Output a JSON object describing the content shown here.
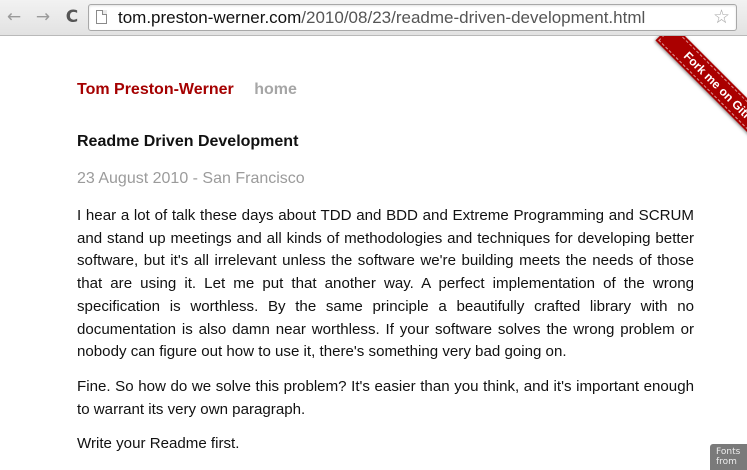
{
  "browser": {
    "url_domain": "tom.preston-werner.com",
    "url_path": "/2010/08/23/readme-driven-development.html",
    "back_icon": "←",
    "forward_icon": "→",
    "reload_icon": "C",
    "bookmark_icon": "☆"
  },
  "ribbon": {
    "label": "Fork me on GitHub"
  },
  "header": {
    "site_title": "Tom Preston-Werner",
    "home_link": "home"
  },
  "post": {
    "title": "Readme Driven Development",
    "meta": "23 August 2010 - San Francisco",
    "paragraphs": [
      "I hear a lot of talk these days about TDD and BDD and Extreme Programming and SCRUM and stand up meetings and all kinds of methodologies and techniques for developing better software, but it's all irrelevant unless the software we're building meets the needs of those that are using it. Let me put that another way. A perfect implementation of the wrong specification is worthless. By the same principle a beautifully crafted library with no documentation is also damn near worthless. If your software solves the wrong problem or nobody can figure out how to use it, there's something very bad going on.",
      "Fine. So how do we solve this problem? It's easier than you think, and it's important enough to warrant its very own paragraph.",
      "Write your Readme first."
    ]
  },
  "badge": {
    "line1": "Fonts",
    "line2": "from"
  },
  "colors": {
    "site_title": "#a50000",
    "ribbon": "#aa0000",
    "muted": "#a6a6a6"
  }
}
